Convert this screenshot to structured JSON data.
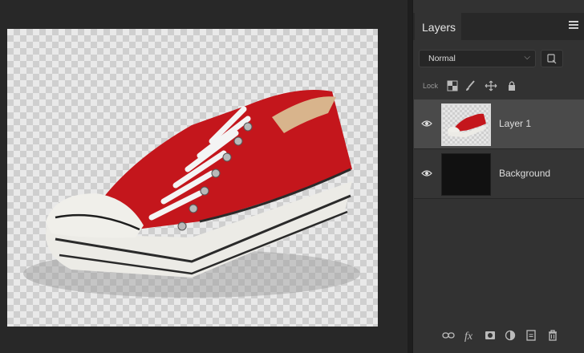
{
  "canvas": {
    "image_description_icon": "red-sneaker-image"
  },
  "panel": {
    "tab_label": "Layers",
    "menu_icon": "hamburger-menu-icon",
    "blend_mode": "Normal",
    "lock_label": "Lock",
    "layers": [
      {
        "name": "Layer 1",
        "selected": true
      },
      {
        "name": "Background",
        "selected": false
      }
    ]
  },
  "footer_icons": [
    "link-icon",
    "fx-icon",
    "mask-icon",
    "adjustment-icon",
    "new-layer-icon",
    "trash-icon"
  ],
  "colors": {
    "panel_bg": "#323232",
    "selected_row": "#4a4a4a",
    "sneaker_red": "#c4161c"
  }
}
